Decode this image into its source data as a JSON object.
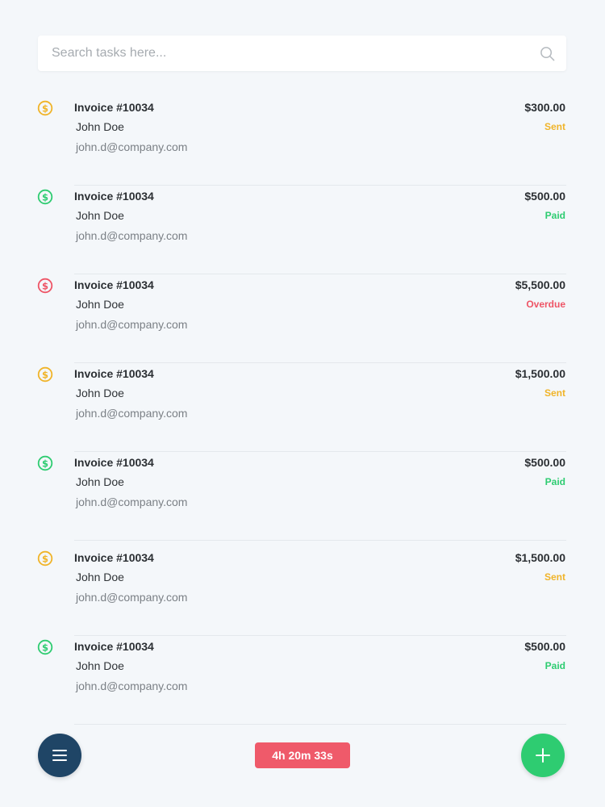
{
  "search": {
    "placeholder": "Search tasks here..."
  },
  "colors": {
    "sent": "#f0b429",
    "paid": "#2ecc71",
    "overdue": "#ee5566",
    "menu_button": "#1f4566",
    "add_button": "#2ecc71",
    "timer": "#ef5a6a"
  },
  "invoices": [
    {
      "title": "Invoice #10034",
      "name": "John Doe",
      "email": "john.d@company.com",
      "amount": "$300.00",
      "status": "Sent",
      "status_key": "sent",
      "icon": "dollar-coin-icon"
    },
    {
      "title": "Invoice #10034",
      "name": "John Doe",
      "email": "john.d@company.com",
      "amount": "$500.00",
      "status": "Paid",
      "status_key": "paid",
      "icon": "dollar-coin-icon"
    },
    {
      "title": "Invoice #10034",
      "name": "John Doe",
      "email": "john.d@company.com",
      "amount": "$5,500.00",
      "status": "Overdue",
      "status_key": "overdue",
      "icon": "dollar-coin-icon"
    },
    {
      "title": "Invoice #10034",
      "name": "John Doe",
      "email": "john.d@company.com",
      "amount": "$1,500.00",
      "status": "Sent",
      "status_key": "sent",
      "icon": "dollar-coin-icon"
    },
    {
      "title": "Invoice #10034",
      "name": "John Doe",
      "email": "john.d@company.com",
      "amount": "$500.00",
      "status": "Paid",
      "status_key": "paid",
      "icon": "dollar-coin-icon"
    },
    {
      "title": "Invoice #10034",
      "name": "John Doe",
      "email": "john.d@company.com",
      "amount": "$1,500.00",
      "status": "Sent",
      "status_key": "sent",
      "icon": "dollar-coin-icon"
    },
    {
      "title": "Invoice #10034",
      "name": "John Doe",
      "email": "john.d@company.com",
      "amount": "$500.00",
      "status": "Paid",
      "status_key": "paid",
      "icon": "dollar-coin-icon"
    }
  ],
  "timer": {
    "label": "4h 20m 33s"
  },
  "icons": {
    "menu": "hamburger-menu-icon",
    "add": "plus-icon",
    "search": "search-icon"
  }
}
